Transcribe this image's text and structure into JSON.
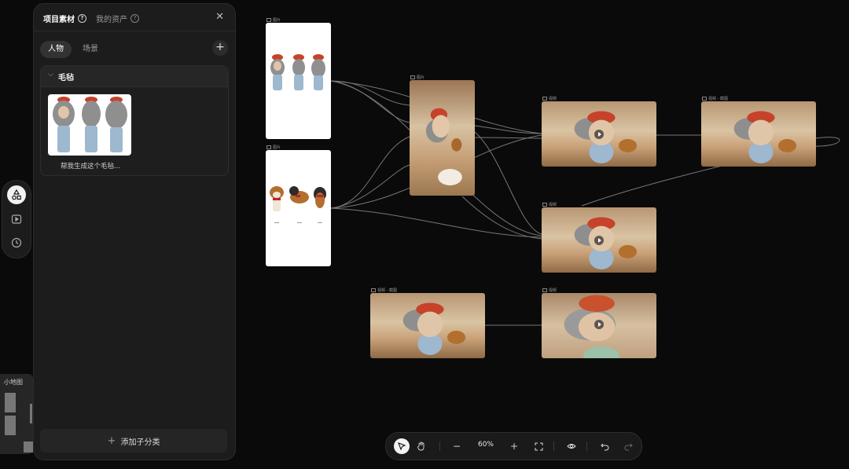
{
  "panel": {
    "tabs": [
      {
        "label": "项目素材",
        "active": true
      },
      {
        "label": "我的资产",
        "active": false
      }
    ],
    "help_icon": "question-circle-icon",
    "close_icon": "close-icon",
    "categories": [
      {
        "label": "人物",
        "selected": true
      },
      {
        "label": "场景",
        "selected": false
      }
    ],
    "add_icon": "plus-icon",
    "group": {
      "title": "毛毡",
      "collapse_icon": "chevron-down-icon",
      "items": [
        {
          "caption": "帮我生成这个毛毡..."
        }
      ]
    },
    "add_subcategory_label": "添加子分类"
  },
  "rail": {
    "items": [
      {
        "icon": "shapes-icon",
        "active": true
      },
      {
        "icon": "video-icon",
        "active": false
      },
      {
        "icon": "clock-icon",
        "active": false
      }
    ]
  },
  "minimap": {
    "title": "小地图"
  },
  "canvas": {
    "nodes": [
      {
        "id": "img1",
        "label": "图片",
        "kind": "image"
      },
      {
        "id": "img2",
        "label": "图片",
        "kind": "image"
      },
      {
        "id": "img3",
        "label": "图片",
        "kind": "image"
      },
      {
        "id": "vid1",
        "label": "视频",
        "kind": "video"
      },
      {
        "id": "vid2",
        "label": "视频 - 截图",
        "kind": "image"
      },
      {
        "id": "vid3",
        "label": "视频",
        "kind": "video"
      },
      {
        "id": "vid4",
        "label": "视频 - 截图",
        "kind": "image"
      },
      {
        "id": "vid5",
        "label": "视频",
        "kind": "video"
      }
    ]
  },
  "toolbar": {
    "select_icon": "cursor-arrow-icon",
    "hand_icon": "hand-icon",
    "zoom_out_icon": "minus-icon",
    "zoom_level": "60%",
    "zoom_in_icon": "plus-icon",
    "fit_icon": "fit-screen-icon",
    "preview_icon": "eye-icon",
    "undo_icon": "undo-icon",
    "redo_icon": "redo-icon"
  },
  "colors": {
    "canvas_bg": "#0a0a0a",
    "panel_bg": "#1c1c1c",
    "connector": "#8a8a8a",
    "beret_red": "#c7422a"
  }
}
